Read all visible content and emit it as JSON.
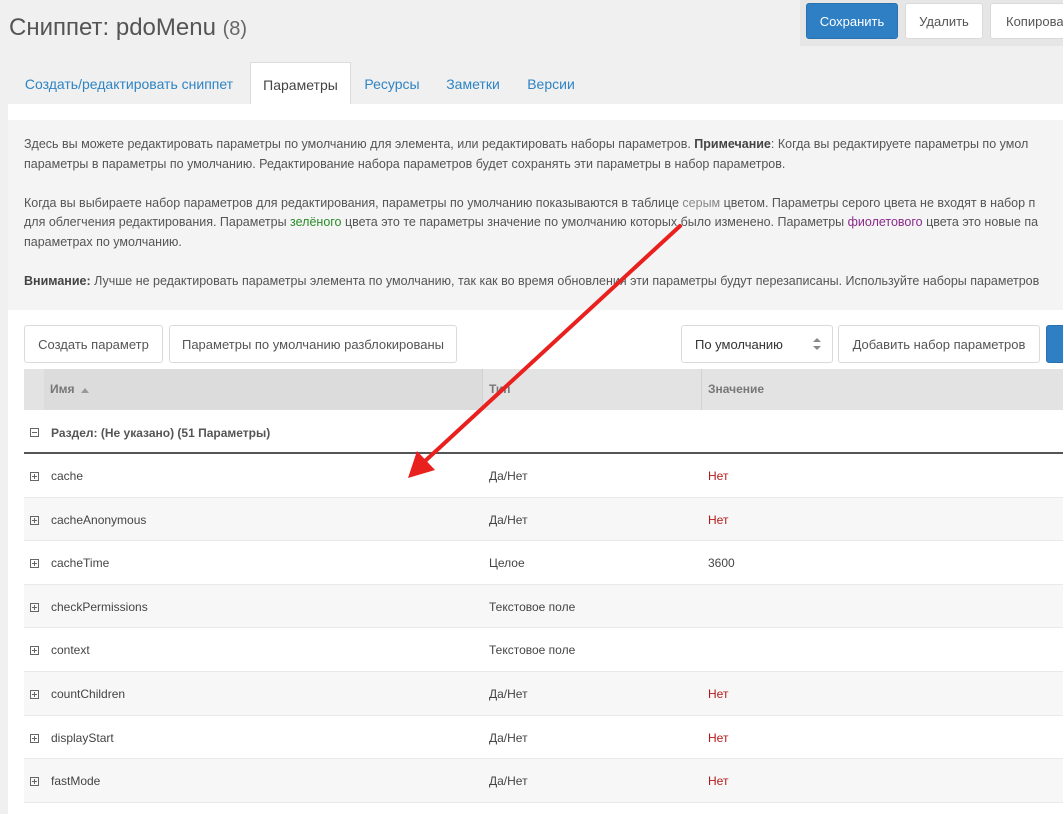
{
  "page": {
    "title": "Сниппет: pdoMenu",
    "title_count": "(8)"
  },
  "actions": {
    "save": "Сохранить",
    "delete": "Удалить",
    "copy": "Копирова"
  },
  "tabs": [
    {
      "label": "Создать/редактировать сниппет",
      "active": false
    },
    {
      "label": "Параметры",
      "active": true
    },
    {
      "label": "Ресурсы",
      "active": false
    },
    {
      "label": "Заметки",
      "active": false
    },
    {
      "label": "Версии",
      "active": false
    }
  ],
  "info": {
    "p1a": "Здесь вы можете редактировать параметры по умолчанию для элемента, или редактировать наборы параметров.",
    "p1_note_label": "Примечание",
    "p1b": ": Когда вы редактируете параметры по умол",
    "p1c": "параметры в параметры по умолчанию. Редактирование набора параметров будет сохранять эти параметры в набор параметров.",
    "p2a": "Когда вы выбираете набор параметров для редактирования, параметры по умолчанию показываются в таблице",
    "p2_gray": "серым",
    "p2b": "цветом. Параметры серого цвета не входят в набор п",
    "p2c": "для облегчения редактирования. Параметры",
    "p2_green": "зелёного",
    "p2d": "цвета это те параметры значение по умолчанию которых было изменено. Параметры",
    "p2_purple": "фиолетового",
    "p2e": "цвета это новые па",
    "p2f": "параметрах по умолчанию.",
    "p3_label": "Внимание:",
    "p3": "Лучше не редактировать параметры элемента по умолчанию, так как во время обновления эти параметры будут перезаписаны. Используйте наборы параметров"
  },
  "toolbar": {
    "create_param": "Создать параметр",
    "defaults_unlocked": "Параметры по умолчанию разблокированы",
    "set_select": "По умолчанию",
    "add_set": "Добавить набор параметров"
  },
  "grid": {
    "columns": {
      "name": "Имя",
      "type": "Тип",
      "value": "Значение"
    },
    "group_label": "Раздел: (Не указано) (51 Параметры)",
    "rows": [
      {
        "name": "cache",
        "type": "Да/Нет",
        "value": "Нет"
      },
      {
        "name": "cacheAnonymous",
        "type": "Да/Нет",
        "value": "Нет"
      },
      {
        "name": "cacheTime",
        "type": "Целое",
        "value": "3600"
      },
      {
        "name": "checkPermissions",
        "type": "Текстовое поле",
        "value": ""
      },
      {
        "name": "context",
        "type": "Текстовое поле",
        "value": ""
      },
      {
        "name": "countChildren",
        "type": "Да/Нет",
        "value": "Нет"
      },
      {
        "name": "displayStart",
        "type": "Да/Нет",
        "value": "Нет"
      },
      {
        "name": "fastMode",
        "type": "Да/Нет",
        "value": "Нет"
      }
    ]
  },
  "colors": {
    "primary": "#2f7fc4",
    "link": "#2f84c4",
    "no_value": "#b51a1a",
    "annotation_arrow": "#e8201e"
  }
}
